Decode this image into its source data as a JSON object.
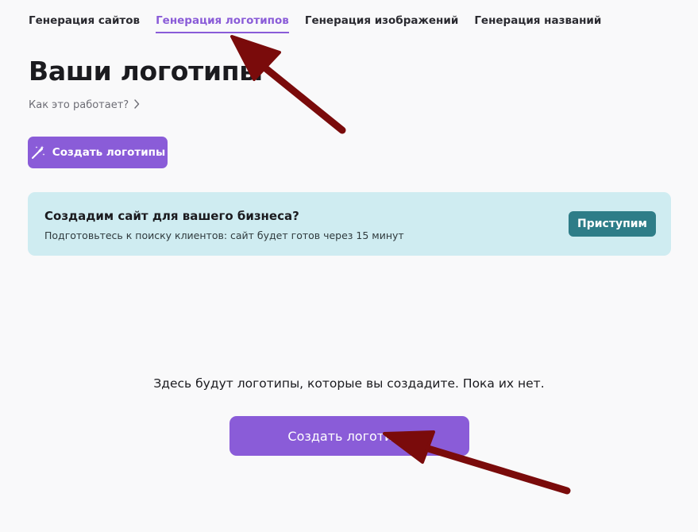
{
  "tabs": [
    {
      "label": "Генерация сайтов",
      "active": false
    },
    {
      "label": "Генерация логотипов",
      "active": true
    },
    {
      "label": "Генерация изображений",
      "active": false
    },
    {
      "label": "Генерация названий",
      "active": false
    }
  ],
  "page": {
    "title": "Ваши логотипы",
    "how_link": "Как это работает?",
    "create_button": "Создать логотипы"
  },
  "promo": {
    "title": "Создадим сайт для вашего бизнеса?",
    "subtitle": "Подготовьтесь к поиску клиентов: сайт будет готов через 15 минут",
    "button": "Приступим"
  },
  "empty_state": {
    "text": "Здесь будут логотипы, которые вы создадите. Пока их нет.",
    "button": "Создать логотипы"
  },
  "colors": {
    "accent": "#8a5cd8",
    "promo_bg": "#cfecf1",
    "promo_button": "#2e7d88",
    "annotation_arrow": "#7a0b0b"
  },
  "icons": {
    "create_button_icon": "magic-wand-icon",
    "how_link_icon": "chevron-right-icon"
  }
}
